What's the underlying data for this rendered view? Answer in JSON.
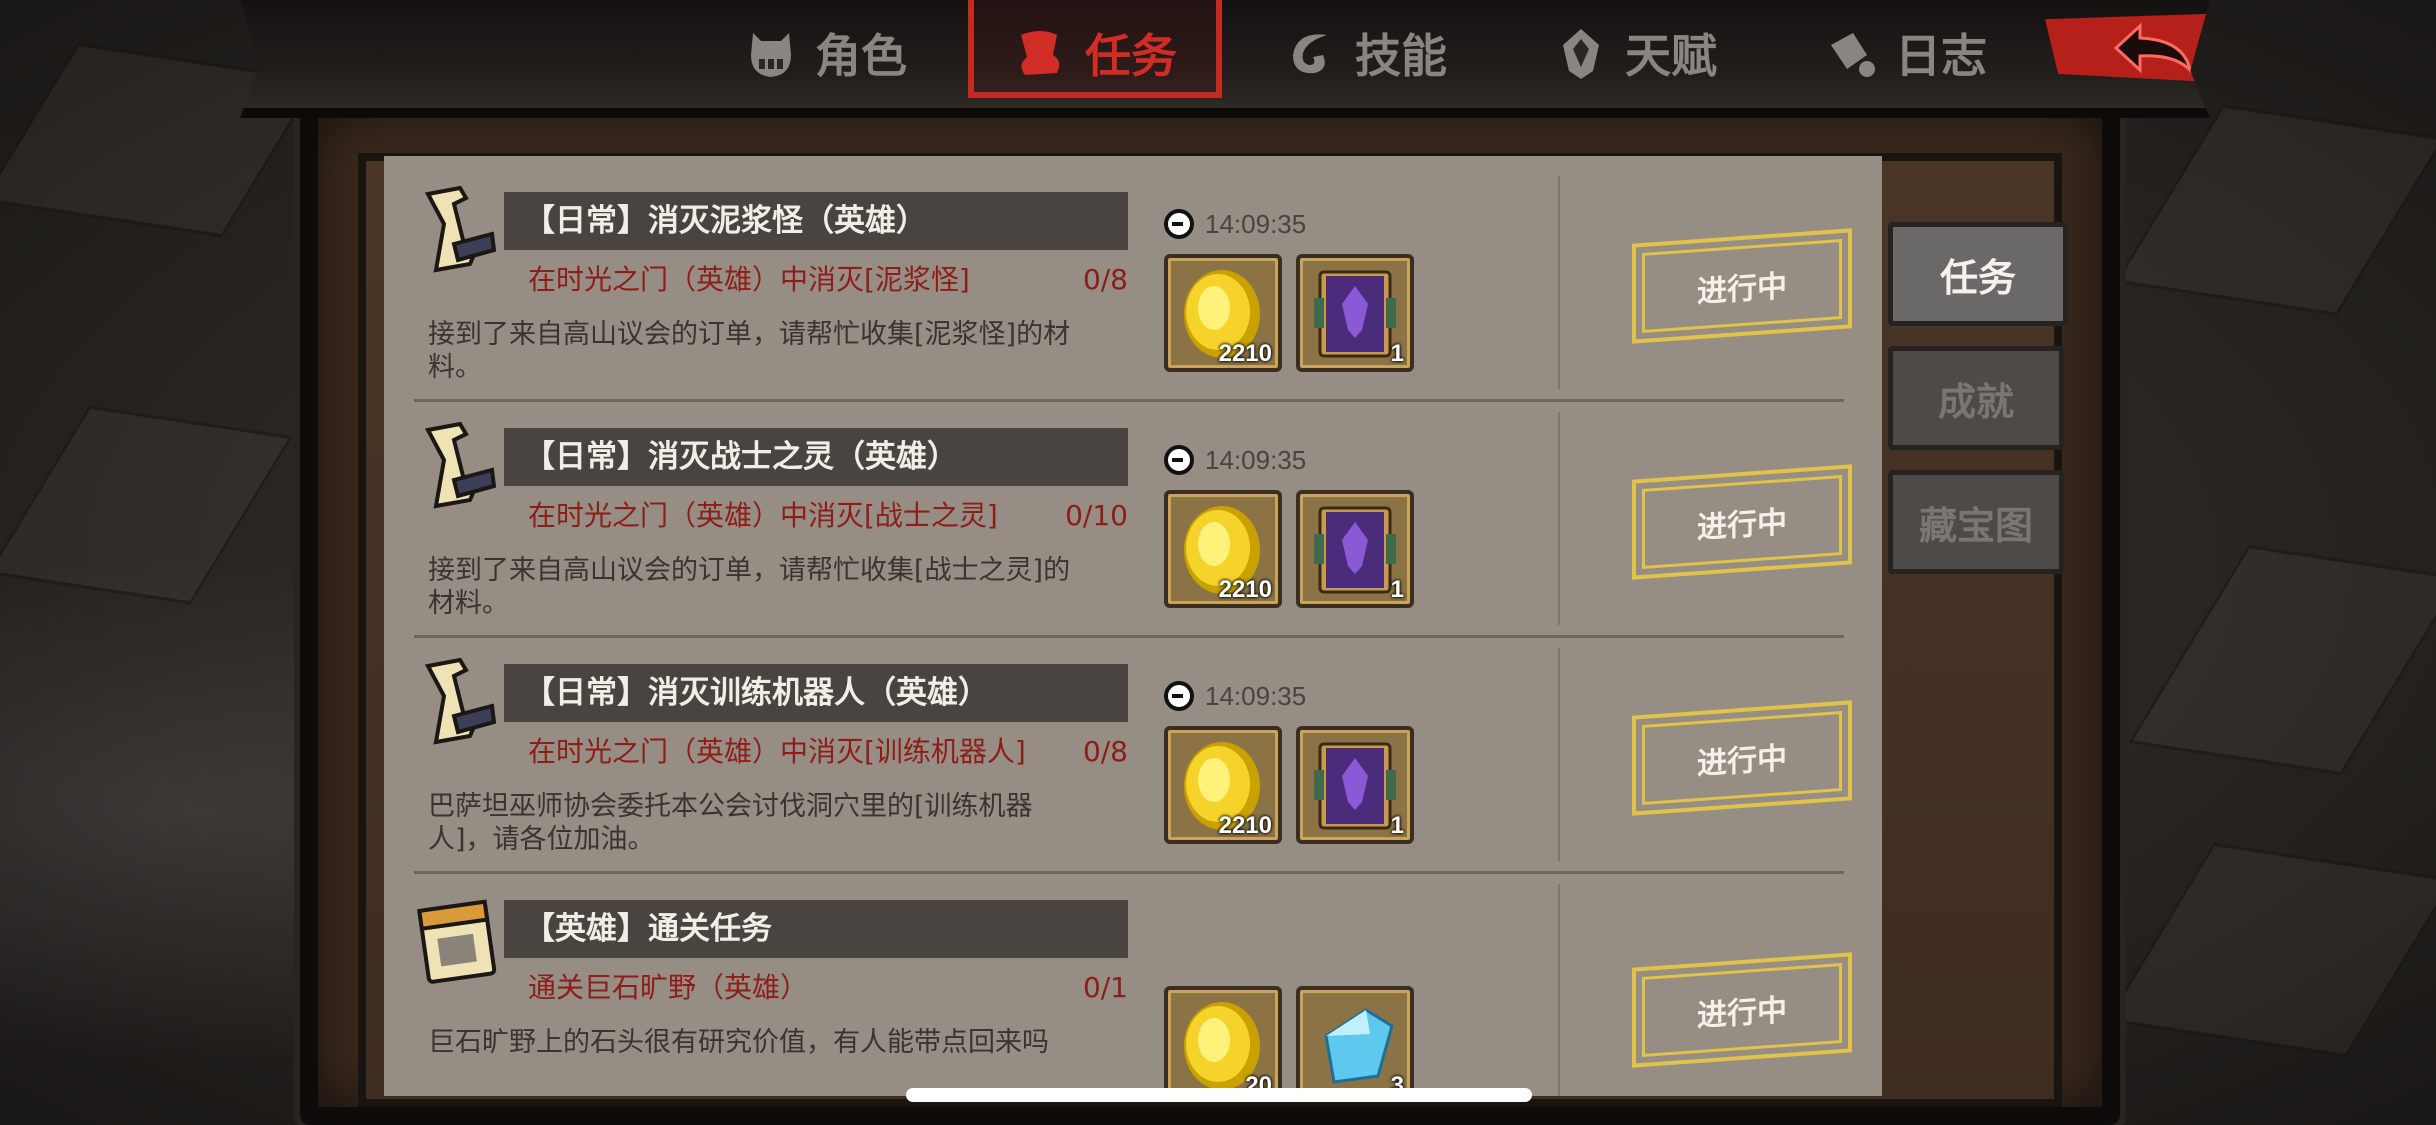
{
  "top_tabs": [
    {
      "label": "角色",
      "icon": "mask-icon"
    },
    {
      "label": "任务",
      "icon": "scroll-icon"
    },
    {
      "label": "技能",
      "icon": "skill-swirl-icon"
    },
    {
      "label": "天赋",
      "icon": "talent-gem-icon"
    },
    {
      "label": "日志",
      "icon": "log-lamp-icon"
    }
  ],
  "active_tab": "任务",
  "back_icon": "back-arrow-icon",
  "quests": [
    {
      "title": "【日常】消灭泥浆怪（英雄）",
      "goal": "在时光之门（英雄）中消灭[泥浆怪]",
      "progress": "0/8",
      "desc": "接到了来自高山议会的订单，请帮忙收集[泥浆怪]的材料。",
      "timer": "14:09:35",
      "rewards": [
        {
          "icon": "gold-coin-icon",
          "count": "2210"
        },
        {
          "icon": "purple-book-icon",
          "count": "1"
        }
      ],
      "status": "进行中"
    },
    {
      "title": "【日常】消灭战士之灵（英雄）",
      "goal": "在时光之门（英雄）中消灭[战士之灵]",
      "progress": "0/10",
      "desc": "接到了来自高山议会的订单，请帮忙收集[战士之灵]的材料。",
      "timer": "14:09:35",
      "rewards": [
        {
          "icon": "gold-coin-icon",
          "count": "2210"
        },
        {
          "icon": "purple-book-icon",
          "count": "1"
        }
      ],
      "status": "进行中"
    },
    {
      "title": "【日常】消灭训练机器人（英雄）",
      "goal": "在时光之门（英雄）中消灭[训练机器人]",
      "progress": "0/8",
      "desc": "巴萨坦巫师协会委托本公会讨伐洞穴里的[训练机器人]，请各位加油。",
      "timer": "14:09:35",
      "rewards": [
        {
          "icon": "gold-coin-icon",
          "count": "2210"
        },
        {
          "icon": "purple-book-icon",
          "count": "1"
        }
      ],
      "status": "进行中"
    },
    {
      "title": "【英雄】通关任务",
      "goal": "通关巨石旷野（英雄）",
      "progress": "0/1",
      "desc": "巨石旷野上的石头很有研究价值，有人能带点回来吗",
      "timer": "",
      "rewards": [
        {
          "icon": "gold-coin-icon",
          "count": "20"
        },
        {
          "icon": "blue-crystal-icon",
          "count": "3"
        }
      ],
      "status": "进行中"
    }
  ],
  "side_tabs": [
    {
      "label": "任务",
      "active": true
    },
    {
      "label": "成就",
      "active": false
    },
    {
      "label": "藏宝图",
      "active": false
    }
  ],
  "colors": {
    "accent_red": "#c22a24",
    "goal_red": "#8e1d18",
    "button_gold": "#e0c34a",
    "panel": "#968d84"
  }
}
